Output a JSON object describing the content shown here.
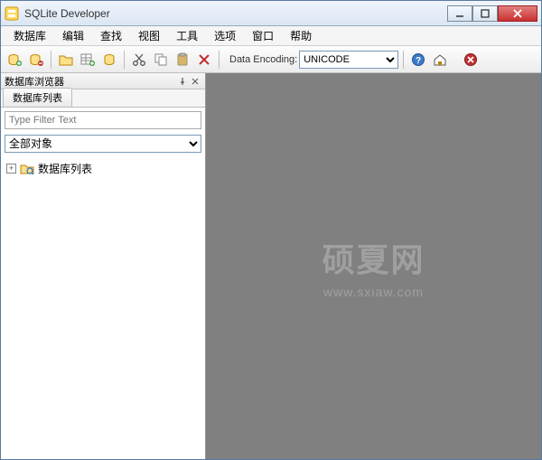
{
  "window": {
    "title": "SQLite Developer"
  },
  "menu": {
    "database": "数据库",
    "edit": "编辑",
    "search": "查找",
    "view": "视图",
    "tools": "工具",
    "options": "选项",
    "window": "窗口",
    "help": "帮助"
  },
  "toolbar": {
    "data_encoding_label": "Data Encoding:",
    "data_encoding_value": "UNICODE"
  },
  "sidebar": {
    "panel_title": "数据库浏览器",
    "tab_label": "数据库列表",
    "filter_placeholder": "Type Filter Text",
    "scope_select": "全部对象",
    "tree_root": "数据库列表"
  },
  "watermark": {
    "title": "硕夏网",
    "url": "www.sxiaw.com"
  }
}
